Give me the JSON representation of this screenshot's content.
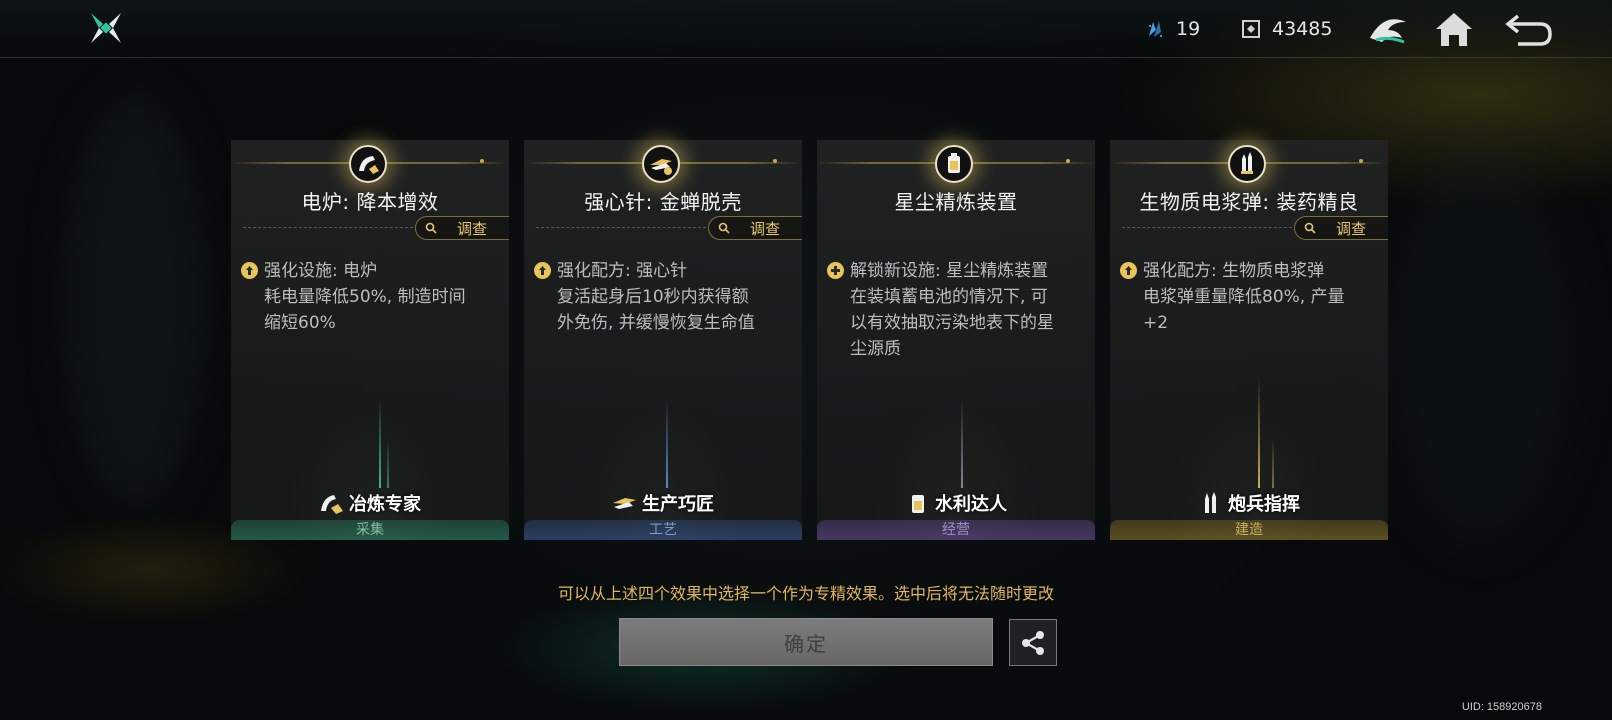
{
  "header": {
    "resources": [
      {
        "icon": "crystal-shard-icon",
        "value": "19"
      },
      {
        "icon": "credit-coin-icon",
        "value": "43485"
      }
    ]
  },
  "cards": [
    {
      "icon": "flask-pour-icon",
      "title": "电炉: 降本增效",
      "inspect_label": "调查",
      "effect_type": "upgrade",
      "effect_text": "强化设施: 电炉\n耗电量降低50%, 制造时间\n缩短60%",
      "specialist": "冶炼专家",
      "category": "采集",
      "accent": "#2e8f6d"
    },
    {
      "icon": "wing-hammer-icon",
      "title": "强心针: 金蝉脱壳",
      "inspect_label": "调查",
      "effect_type": "upgrade",
      "effect_text": "强化配方: 强心针\n复活起身后10秒内获得额\n外免伤, 并缓慢恢复生命值",
      "specialist": "生产巧匠",
      "category": "工艺",
      "accent": "#4b79b8"
    },
    {
      "icon": "water-tank-icon",
      "title": "星尘精炼装置",
      "inspect_label": "",
      "effect_type": "unlock",
      "effect_text": "解锁新设施: 星尘精炼装置\n在装填蓄电池的情况下, 可\n以有效抽取污染地表下的星\n尘源质",
      "specialist": "水利达人",
      "category": "经营",
      "accent": "#8060b0"
    },
    {
      "icon": "artillery-shell-icon",
      "title": "生物质电浆弹: 装药精良",
      "inspect_label": "调查",
      "effect_type": "upgrade",
      "effect_text": "强化配方: 生物质电浆弹\n电浆弹重量降低80%, 产量\n+2",
      "specialist": "炮兵指挥",
      "category": "建造",
      "accent": "#b89a30"
    }
  ],
  "footer": {
    "hint": "可以从上述四个效果中选择一个作为专精效果。选中后将无法随时更改",
    "confirm_label": "确定",
    "uid": "UID: 158920678"
  },
  "colors": {
    "gold": "#e0b75c",
    "confirm_disabled": "#6e6e6e"
  }
}
